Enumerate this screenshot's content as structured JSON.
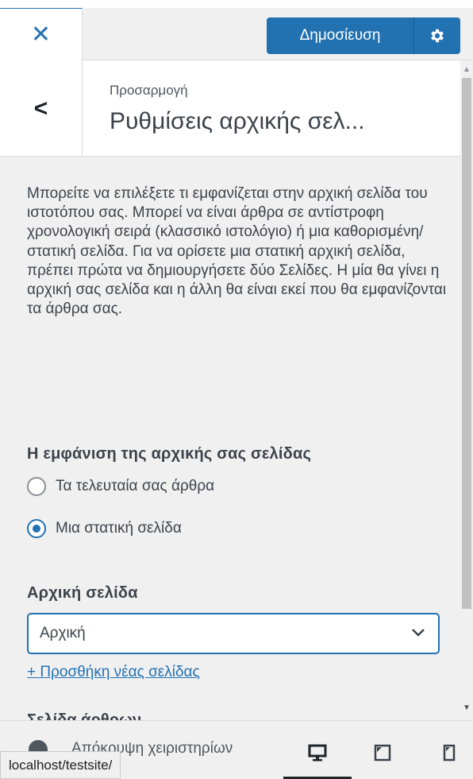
{
  "header": {
    "close_icon": "close-icon",
    "publish_label": "Δημοσίευση",
    "settings_icon": "gear-icon"
  },
  "section": {
    "back_icon": "chevron-left-icon",
    "breadcrumb": "Προσαρμογή",
    "title": "Ρυθμίσεις αρχικής σελ..."
  },
  "content": {
    "description": "Μπορείτε να επιλέξετε τι εμφανίζεται στην αρχική σελίδα του ιστοτόπου σας. Μπορεί να είναι άρθρα σε αντίστροφη χρονολογική σειρά (κλασσικό ιστολόγιο) ή μια καθορισμένη/στατική σελίδα. Για να ορίσετε μια στατική αρχική σελίδα, πρέπει πρώτα να δημιουργήσετε δύο Σελίδες. Η μία θα γίνει η αρχική σας σελίδα και η άλλη θα είναι εκεί που θα εμφανίζονται τα άρθρα σας.",
    "display_heading": "Η εμφάνιση της αρχικής σας σελίδας",
    "options": [
      {
        "label": "Τα τελευταία σας άρθρα",
        "checked": false
      },
      {
        "label": "Μια στατική σελίδα",
        "checked": true
      }
    ],
    "homepage_heading": "Αρχική σελίδα",
    "homepage_select_value": "Αρχική",
    "add_page_link": "+ Προσθήκη νέας σελίδας",
    "posts_page_heading": "Σελίδα άρθρων"
  },
  "footer": {
    "collapse_label": "Απόκρυψη χειριστηρίων",
    "devices": [
      "desktop-icon",
      "tablet-icon",
      "mobile-icon"
    ],
    "active_device": "desktop"
  },
  "statusbar": {
    "url": "localhost/testsite/"
  },
  "colors": {
    "accent": "#2271b1",
    "background": "#f0f0f1",
    "text": "#3c434a"
  }
}
